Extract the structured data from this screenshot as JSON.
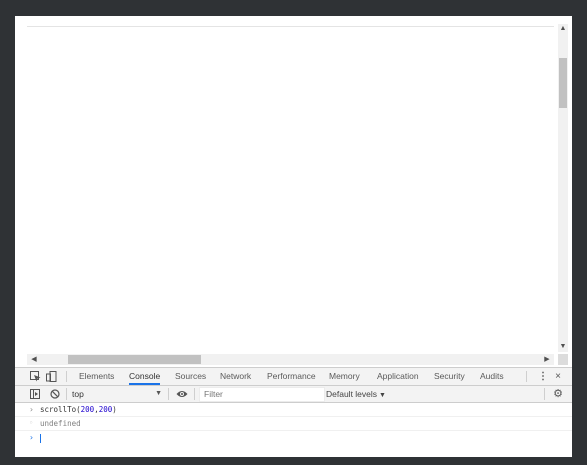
{
  "devtools": {
    "tabs": [
      {
        "label": "Elements"
      },
      {
        "label": "Console"
      },
      {
        "label": "Sources"
      },
      {
        "label": "Network"
      },
      {
        "label": "Performance"
      },
      {
        "label": "Memory"
      },
      {
        "label": "Application"
      },
      {
        "label": "Security"
      },
      {
        "label": "Audits"
      }
    ],
    "active_tab": "Console",
    "kebab_label": "⋮",
    "close_label": "×"
  },
  "console_toolbar": {
    "context": "top",
    "filter_placeholder": "Filter",
    "levels_label": "Default levels"
  },
  "console": {
    "command": {
      "fn": "scrollTo(",
      "arg1": "200",
      "comma": ",",
      "arg2": "200",
      "close": ")"
    },
    "result": "undefined"
  },
  "colors": {
    "active_tab_underline": "#1a73e8",
    "number_literal": "#1c00cf",
    "prompt": "#1a73e8"
  },
  "icons": [
    "inspect-element-icon",
    "device-toolbar-icon",
    "sidebar-toggle-icon",
    "clear-console-icon",
    "eye-icon",
    "gear-icon"
  ]
}
